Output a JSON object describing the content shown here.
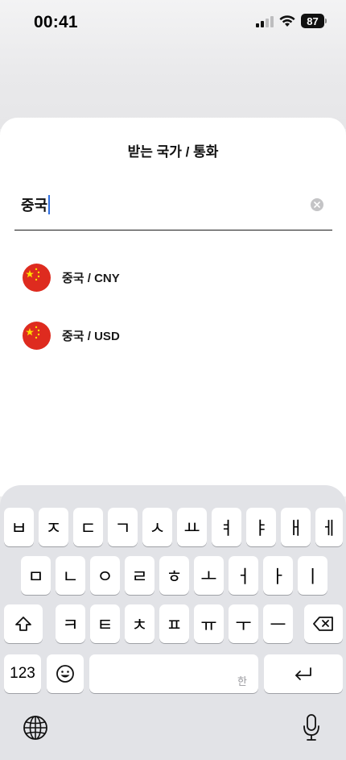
{
  "status": {
    "time": "00:41",
    "battery": "87"
  },
  "sheet": {
    "title": "받는 국가 / 통화",
    "search": {
      "value": "중국"
    },
    "results": [
      {
        "label": "중국 / CNY",
        "flag": "china-flag"
      },
      {
        "label": "중국 / USD",
        "flag": "china-flag"
      }
    ],
    "accent": "#2f6fe0",
    "flag_color": "#de2b1f"
  },
  "keyboard": {
    "row1": [
      "ㅂ",
      "ㅈ",
      "ㄷ",
      "ㄱ",
      "ㅅ",
      "ㅛ",
      "ㅕ",
      "ㅑ",
      "ㅐ",
      "ㅔ"
    ],
    "row2": [
      "ㅁ",
      "ㄴ",
      "ㅇ",
      "ㄹ",
      "ㅎ",
      "ㅗ",
      "ㅓ",
      "ㅏ",
      "ㅣ"
    ],
    "row3": [
      "ㅋ",
      "ㅌ",
      "ㅊ",
      "ㅍ",
      "ㅠ",
      "ㅜ",
      "ㅡ"
    ],
    "numbers_label": "123",
    "space_hint": "한",
    "icons": {
      "shift": "shift-icon",
      "delete": "delete-icon",
      "emoji": "emoji-icon",
      "return": "return-icon",
      "globe": "globe-icon",
      "mic": "microphone-icon"
    }
  }
}
